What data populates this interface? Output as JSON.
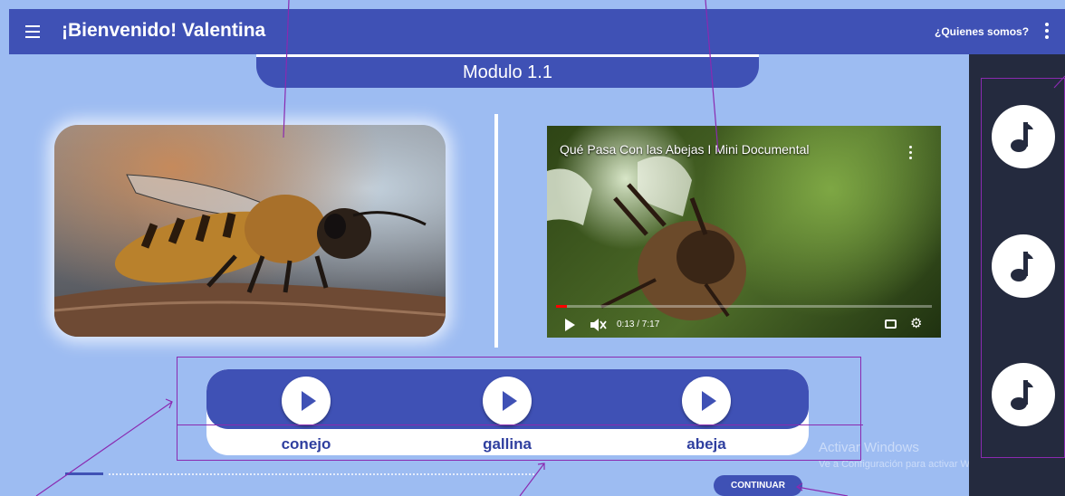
{
  "appbar": {
    "title": "¡Bienvenido! Valentina",
    "about_label": "¿Quienes somos?",
    "menu_icon": "hamburger-menu-icon",
    "more_icon": "more-vert-icon"
  },
  "module": {
    "title": "Modulo 1.1"
  },
  "photo": {
    "subject": "bee-photo"
  },
  "video": {
    "title": "Qué Pasa Con las Abejas I Mini Documental",
    "time": "0:13 / 7:17",
    "progress": 0.03,
    "muted": true
  },
  "words": [
    {
      "label": "conejo"
    },
    {
      "label": "gallina"
    },
    {
      "label": "abeja"
    }
  ],
  "progress_dots": {
    "current": 1
  },
  "actions": {
    "continue_label": "CONTINUAR"
  },
  "watermark": {
    "line1": "Activar Windows",
    "line2": "Ve a Configuración para activar Windows."
  },
  "sidebar": {
    "items": [
      {
        "icon": "music-note-icon"
      },
      {
        "icon": "music-note-icon"
      },
      {
        "icon": "music-note-icon"
      }
    ]
  },
  "colors": {
    "primary": "#3f51b5",
    "background": "#9dbcf2",
    "sidebar": "#242a3e",
    "annotation": "#8a2ab0"
  }
}
